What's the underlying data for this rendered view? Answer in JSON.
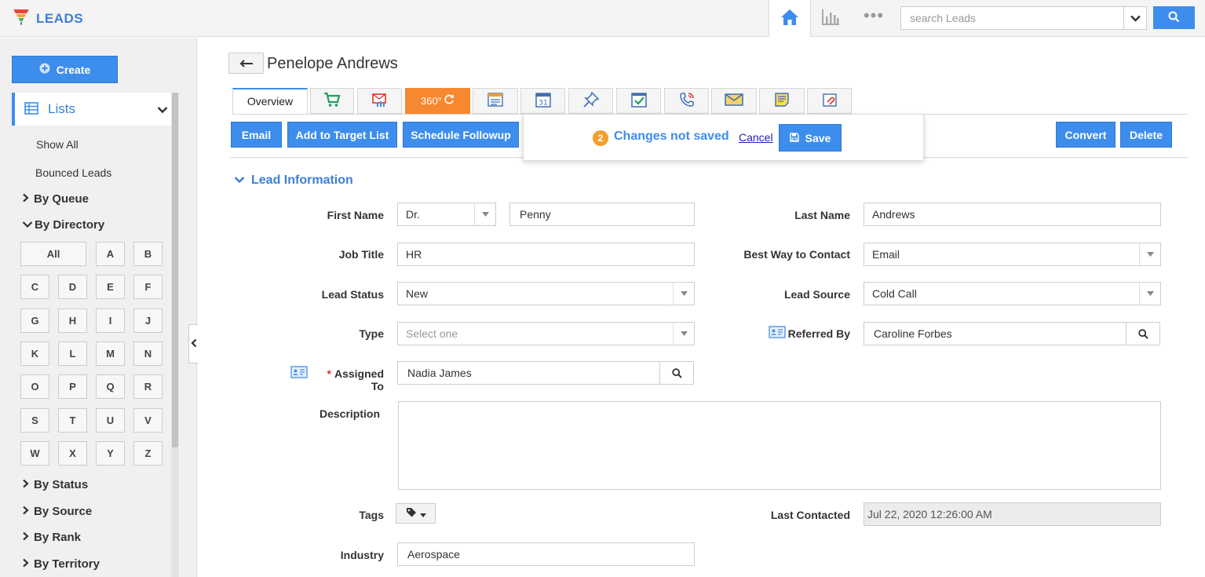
{
  "app": {
    "title": "LEADS"
  },
  "topbar": {
    "search_placeholder": "search Leads"
  },
  "sidebar": {
    "create_label": "Create",
    "lists_label": "Lists",
    "links": [
      "Show All",
      "Bounced Leads"
    ],
    "groups": {
      "queue": "By Queue",
      "directory": "By Directory",
      "status": "By Status",
      "source": "By Source",
      "rank": "By Rank",
      "territory": "By Territory"
    },
    "letters": [
      "All",
      "A",
      "B",
      "C",
      "D",
      "E",
      "F",
      "G",
      "H",
      "I",
      "J",
      "K",
      "L",
      "M",
      "N",
      "O",
      "P",
      "Q",
      "R",
      "S",
      "T",
      "U",
      "V",
      "W",
      "X",
      "Y",
      "Z"
    ]
  },
  "record": {
    "title": "Penelope Andrews"
  },
  "tabs": {
    "overview": "Overview",
    "view360": "360°"
  },
  "actions": {
    "email": "Email",
    "add_target": "Add to Target List",
    "schedule": "Schedule Followup",
    "convert": "Convert",
    "delete": "Delete"
  },
  "unsaved": {
    "count": "2",
    "message": "Changes not saved",
    "cancel": "Cancel",
    "save": "Save"
  },
  "section": {
    "title": "Lead Information"
  },
  "form": {
    "first_name_label": "First Name",
    "salutation": "Dr.",
    "first_name": "Penny",
    "last_name_label": "Last Name",
    "last_name": "Andrews",
    "job_title_label": "Job Title",
    "job_title": "HR",
    "best_way_label": "Best Way to Contact",
    "best_way": "Email",
    "lead_status_label": "Lead Status",
    "lead_status": "New",
    "lead_source_label": "Lead Source",
    "lead_source": "Cold Call",
    "type_label": "Type",
    "type_placeholder": "Select one",
    "referred_by_label": "Referred By",
    "referred_by": "Caroline Forbes",
    "assigned_to_label": "Assigned To",
    "assigned_to": "Nadia James",
    "description_label": "Description",
    "tags_label": "Tags",
    "last_contacted_label": "Last Contacted",
    "last_contacted": "Jul 22, 2020 12:26:00 AM",
    "industry_label": "Industry",
    "industry": "Aerospace"
  },
  "colors": {
    "accent": "#3d8ded",
    "orange": "#f7882f",
    "badge": "#f0a030"
  }
}
